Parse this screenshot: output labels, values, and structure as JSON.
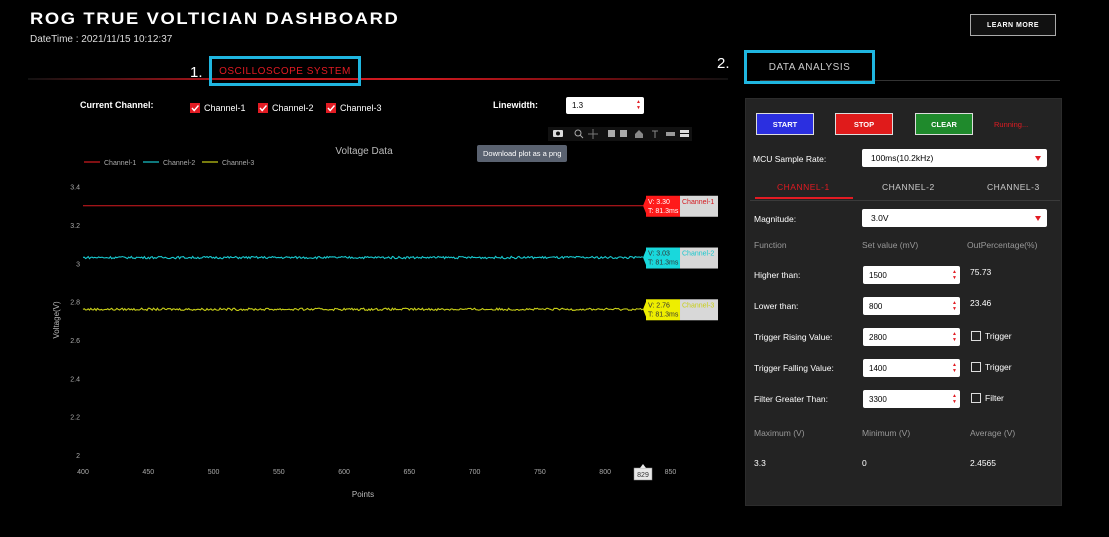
{
  "header": {
    "title": "ROG TRUE VOLTICIAN DASHBOARD",
    "datetime": "DateTime : 2021/11/15 10:12:37",
    "learn_more": "LEARN MORE"
  },
  "sections": {
    "oscilloscope_marker": "1.",
    "oscilloscope_label": "OSCILLOSCOPE SYSTEM",
    "analysis_marker": "2.",
    "analysis_label": "DATA ANALYSIS"
  },
  "controls": {
    "current_channel_label": "Current Channel:",
    "channels": [
      "Channel-1",
      "Channel-2",
      "Channel-3"
    ],
    "linewidth_label": "Linewidth:",
    "linewidth_value": "1.3"
  },
  "plot_tooltip": "Download plot as a png",
  "chart_data": {
    "type": "line",
    "title": "Voltage Data",
    "xlabel": "Points",
    "ylabel": "Voltage(V)",
    "xlim": [
      400,
      865
    ],
    "ylim": [
      2,
      3.45
    ],
    "xticks": [
      400,
      450,
      500,
      550,
      600,
      650,
      700,
      750,
      800,
      850
    ],
    "yticks": [
      2,
      2.2,
      2.4,
      2.6,
      2.8,
      3,
      3.2,
      3.4
    ],
    "hover_x": 829,
    "legend_position": "top-left",
    "series": [
      {
        "name": "Channel-1",
        "color": "#d51a20",
        "value": 3.3,
        "noise": 0.0,
        "hover_v": "V: 3.30",
        "hover_t": "T: 81.3ms",
        "hover_bg": "#ff1a1a"
      },
      {
        "name": "Channel-2",
        "color": "#18c9cf",
        "value": 3.03,
        "noise": 0.006,
        "hover_v": "V: 3.03",
        "hover_t": "T: 81.3ms",
        "hover_bg": "#19d8dc"
      },
      {
        "name": "Channel-3",
        "color": "#c9cf18",
        "value": 2.76,
        "noise": 0.006,
        "hover_v": "V: 2.76",
        "hover_t": "T: 81.3ms",
        "hover_bg": "#eeee00"
      }
    ]
  },
  "analysis": {
    "start": "START",
    "stop": "STOP",
    "clear": "CLEAR",
    "status": "Running...",
    "sample_rate_label": "MCU Sample Rate:",
    "sample_rate_value": "100ms(10.2kHz)",
    "tabs": [
      "CHANNEL-1",
      "CHANNEL-2",
      "CHANNEL-3"
    ],
    "active_tab": 0,
    "magnitude_label": "Magnitude:",
    "magnitude_value": "3.0V",
    "col_function": "Function",
    "col_set": "Set value (mV)",
    "col_out": "OutPercentage(%)",
    "rows": [
      {
        "label": "Higher than:",
        "value": "1500",
        "out": "75.73"
      },
      {
        "label": "Lower than:",
        "value": "800",
        "out": "23.46"
      },
      {
        "label": "Trigger Rising Value:",
        "value": "2800",
        "check": "Trigger"
      },
      {
        "label": "Trigger Falling Value:",
        "value": "1400",
        "check": "Trigger"
      },
      {
        "label": "Filter Greater Than:",
        "value": "3300",
        "check": "Filter"
      }
    ],
    "max_label": "Maximum (V)",
    "min_label": "Minimum (V)",
    "avg_label": "Average (V)",
    "max_value": "3.3",
    "min_value": "0",
    "avg_value": "2.4565"
  },
  "colors": {
    "accent_red": "#e21b23",
    "highlight_cyan": "#1fb6e0",
    "start_blue": "#2b2fe0",
    "stop_red": "#e01b1b",
    "clear_green": "#1f8a2c"
  }
}
